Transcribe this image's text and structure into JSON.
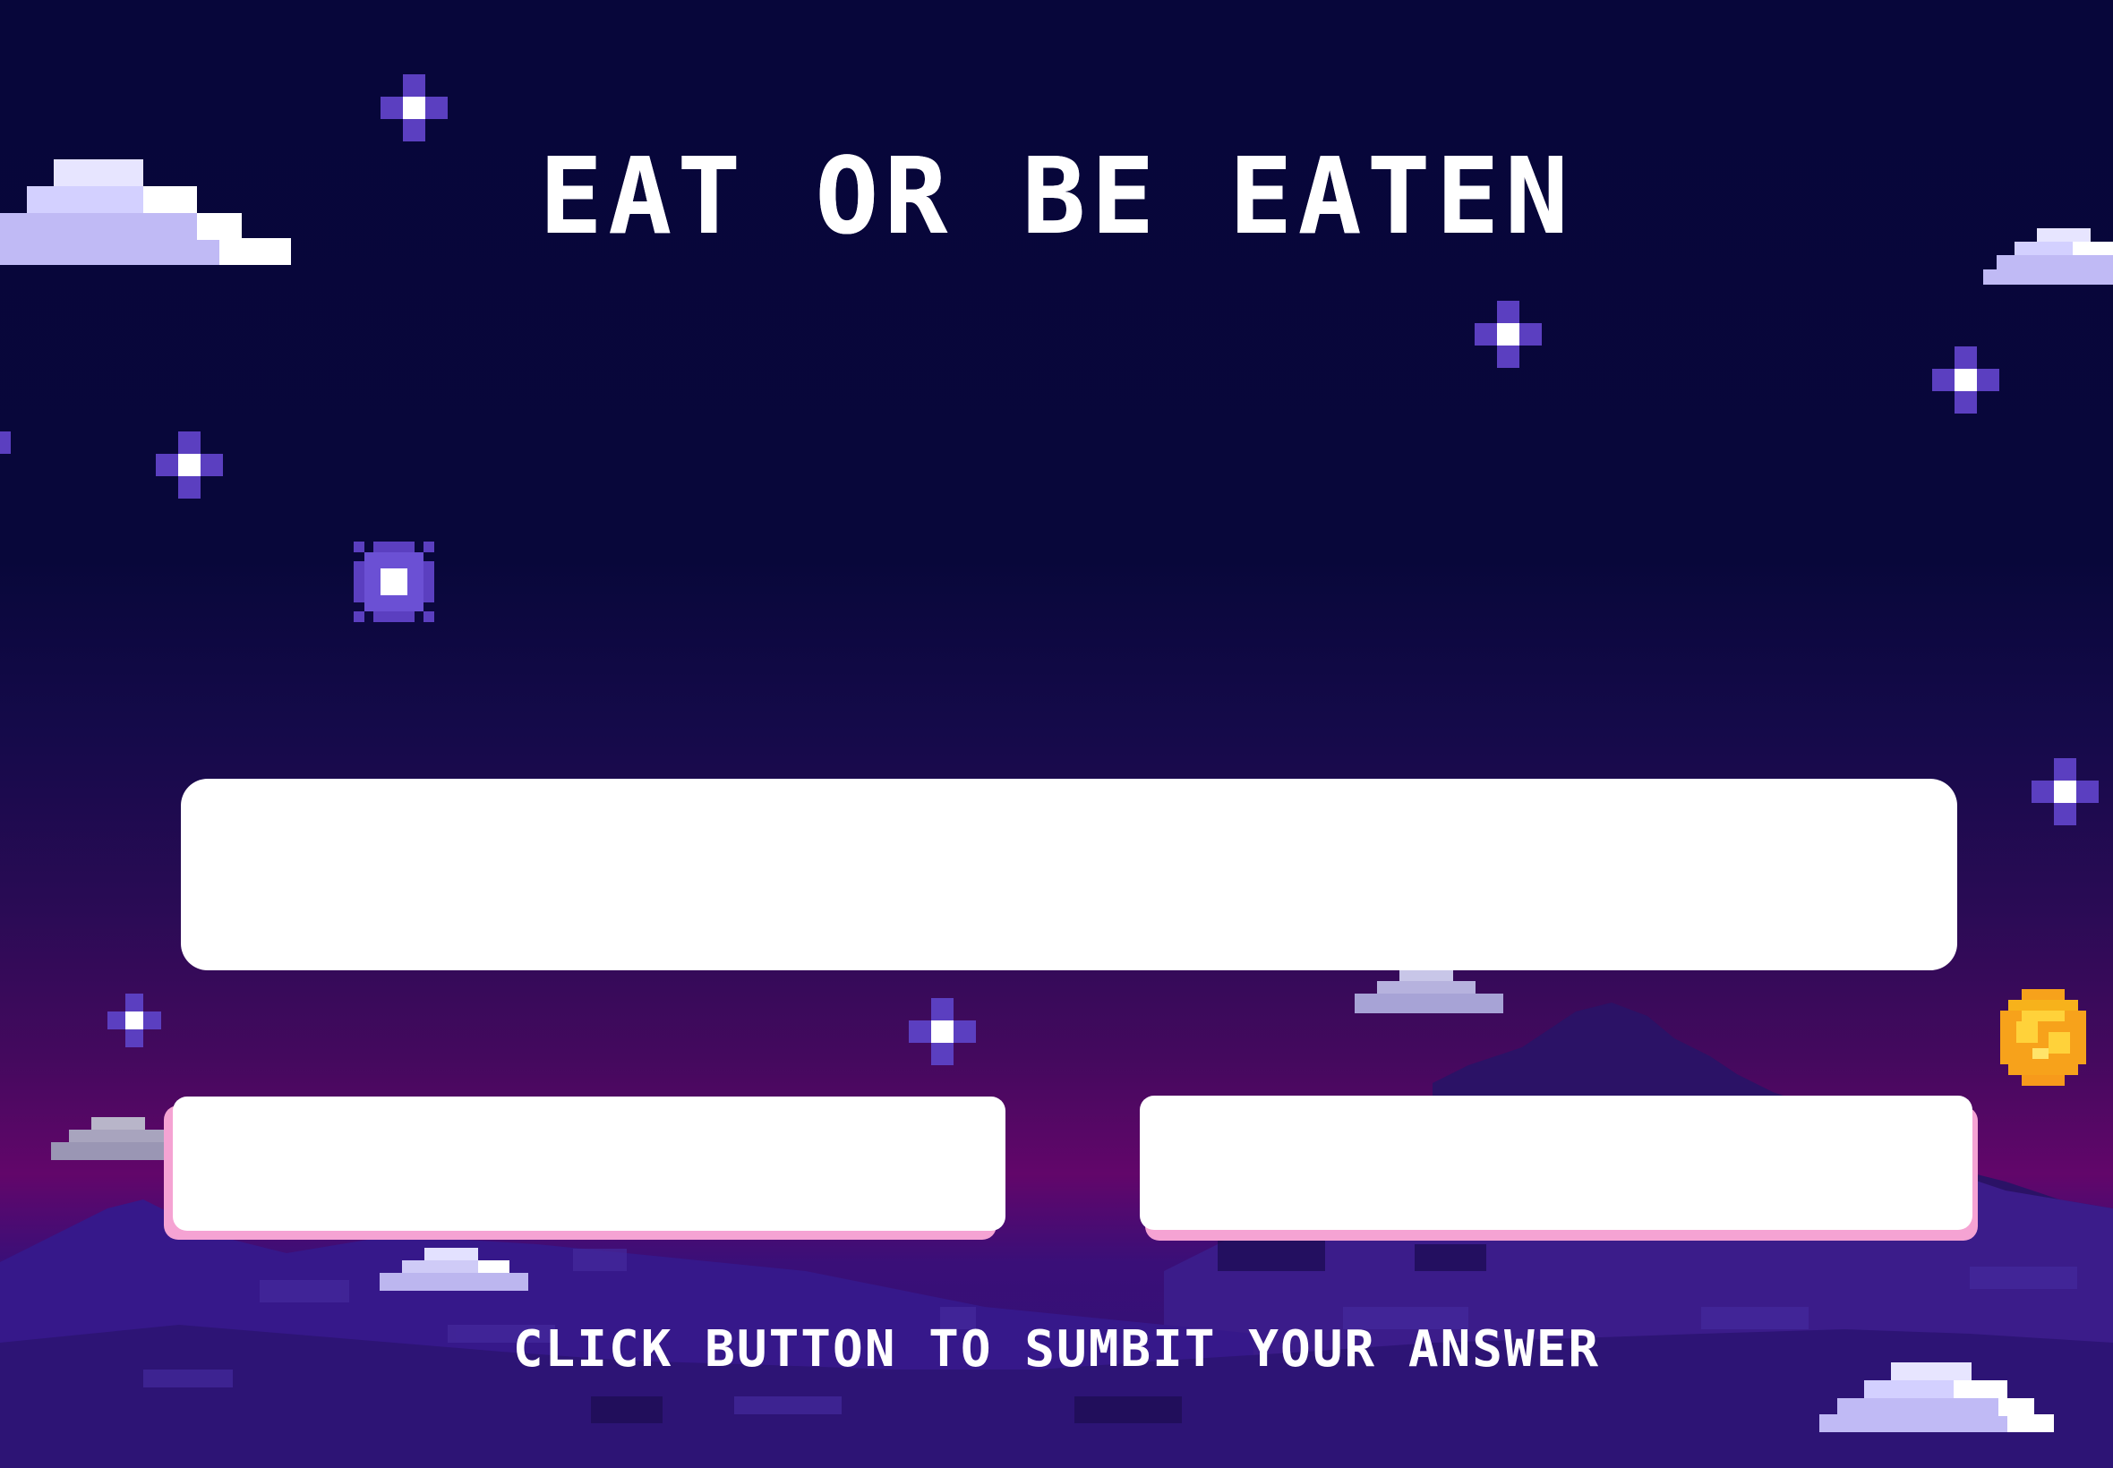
{
  "game": {
    "title": "EAT OR BE EATEN",
    "question": "",
    "answers": {
      "left": "",
      "right": ""
    },
    "instruction": "CLICK BUTTON TO SUMBIT YOUR ANSWER"
  },
  "palette": {
    "sky_top": "#07063a",
    "sky_bottom": "#62066a",
    "star": "#5b3fc0",
    "panel": "#ffffff",
    "button_shadow": "#f5a3d3",
    "coin": "#f7a21b"
  },
  "icons": [
    "star-icon",
    "cloud-icon",
    "coin-icon",
    "hills-background"
  ]
}
